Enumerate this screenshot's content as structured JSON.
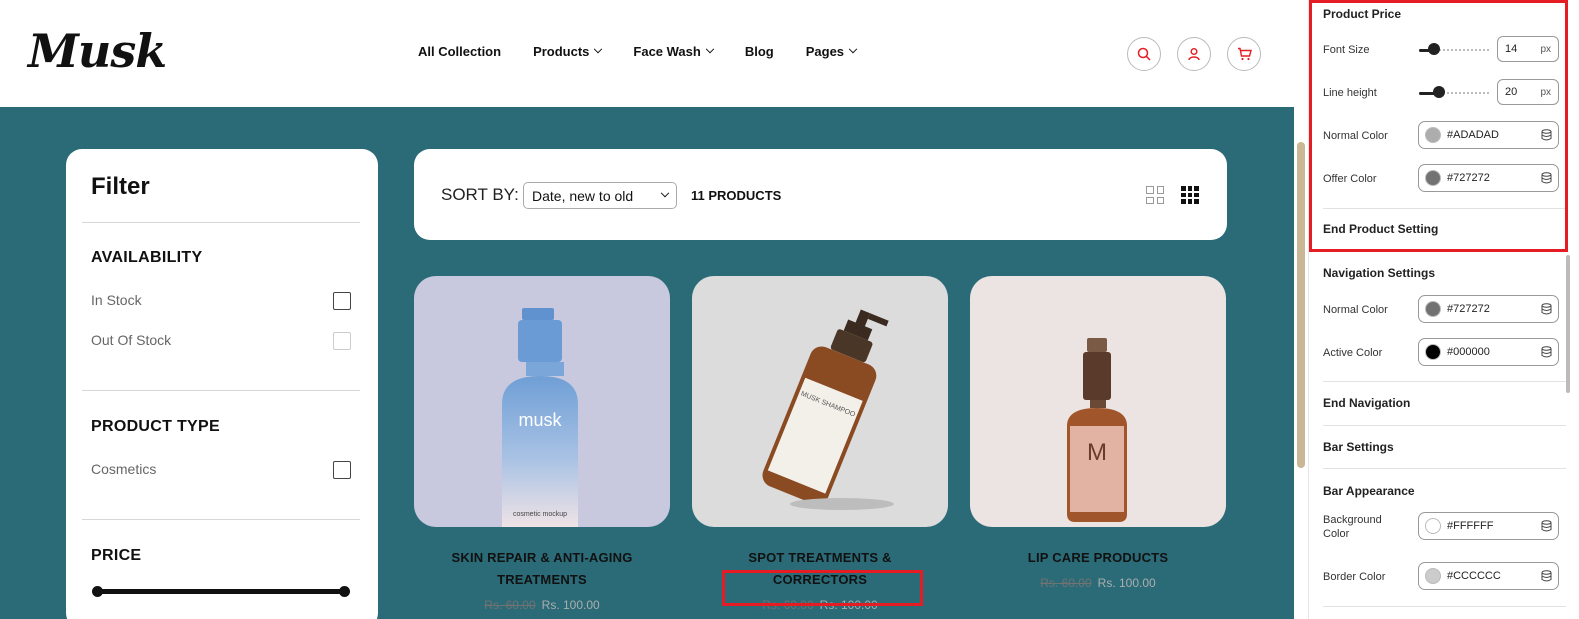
{
  "header": {
    "logo": "Musk",
    "nav": [
      {
        "label": "All Collection",
        "dropdown": false
      },
      {
        "label": "Products",
        "dropdown": true
      },
      {
        "label": "Face Wash",
        "dropdown": true
      },
      {
        "label": "Blog",
        "dropdown": false
      },
      {
        "label": "Pages",
        "dropdown": true
      }
    ],
    "icons": [
      "search-icon",
      "user-icon",
      "cart-icon"
    ],
    "accent": "#e51c23"
  },
  "filter": {
    "title": "Filter",
    "availability": {
      "heading": "AVAILABILITY",
      "options": [
        {
          "label": "In Stock",
          "checked": false,
          "disabled": false
        },
        {
          "label": "Out Of Stock",
          "checked": false,
          "disabled": true
        }
      ]
    },
    "product_type": {
      "heading": "PRODUCT TYPE",
      "options": [
        {
          "label": "Cosmetics",
          "checked": false
        }
      ]
    },
    "price": {
      "heading": "PRICE"
    }
  },
  "toolbar": {
    "sort_label": "SORT BY:",
    "sort_value": "Date, new to old",
    "product_count": "11 PRODUCTS"
  },
  "products": [
    {
      "name": "SKIN REPAIR & ANTI-AGING TREATMENTS",
      "price_old": "Rs. 60.00",
      "price_new": "Rs. 100.00",
      "bottle_text": "musk",
      "bottle_subtext": "cosmetic mockup",
      "bg": "#c8c9de"
    },
    {
      "name": "SPOT TREATMENTS & CORRECTORS",
      "price_old": "Rs. 60.00",
      "price_new": "Rs. 100.00",
      "bottle_text": "MUSK SHAMPOO",
      "bg": "#dcdcdc"
    },
    {
      "name": "LIP CARE PRODUCTS",
      "price_old": "Rs. 60.00",
      "price_new": "Rs. 100.00",
      "bottle_text": "M",
      "bg": "#ece4e2"
    }
  ],
  "settings": {
    "product_price": {
      "title": "Product Price",
      "font_size": {
        "label": "Font Size",
        "value": "14",
        "unit": "px",
        "level": 0.22
      },
      "line_height": {
        "label": "Line height",
        "value": "20",
        "unit": "px",
        "level": 0.28
      },
      "normal_color": {
        "label": "Normal Color",
        "value": "#ADADAD"
      },
      "offer_color": {
        "label": "Offer Color",
        "value": "#727272"
      }
    },
    "end_product": "End Product Setting",
    "navigation": {
      "title": "Navigation Settings",
      "normal_color": {
        "label": "Normal Color",
        "value": "#727272"
      },
      "active_color": {
        "label": "Active Color",
        "value": "#000000"
      }
    },
    "end_navigation": "End Navigation",
    "bar_settings": "Bar Settings",
    "bar_appearance": {
      "title": "Bar Appearance",
      "background_color": {
        "label": "Background Color",
        "value": "#FFFFFF"
      },
      "border_color": {
        "label": "Border Color",
        "value": "#CCCCCC"
      }
    }
  }
}
